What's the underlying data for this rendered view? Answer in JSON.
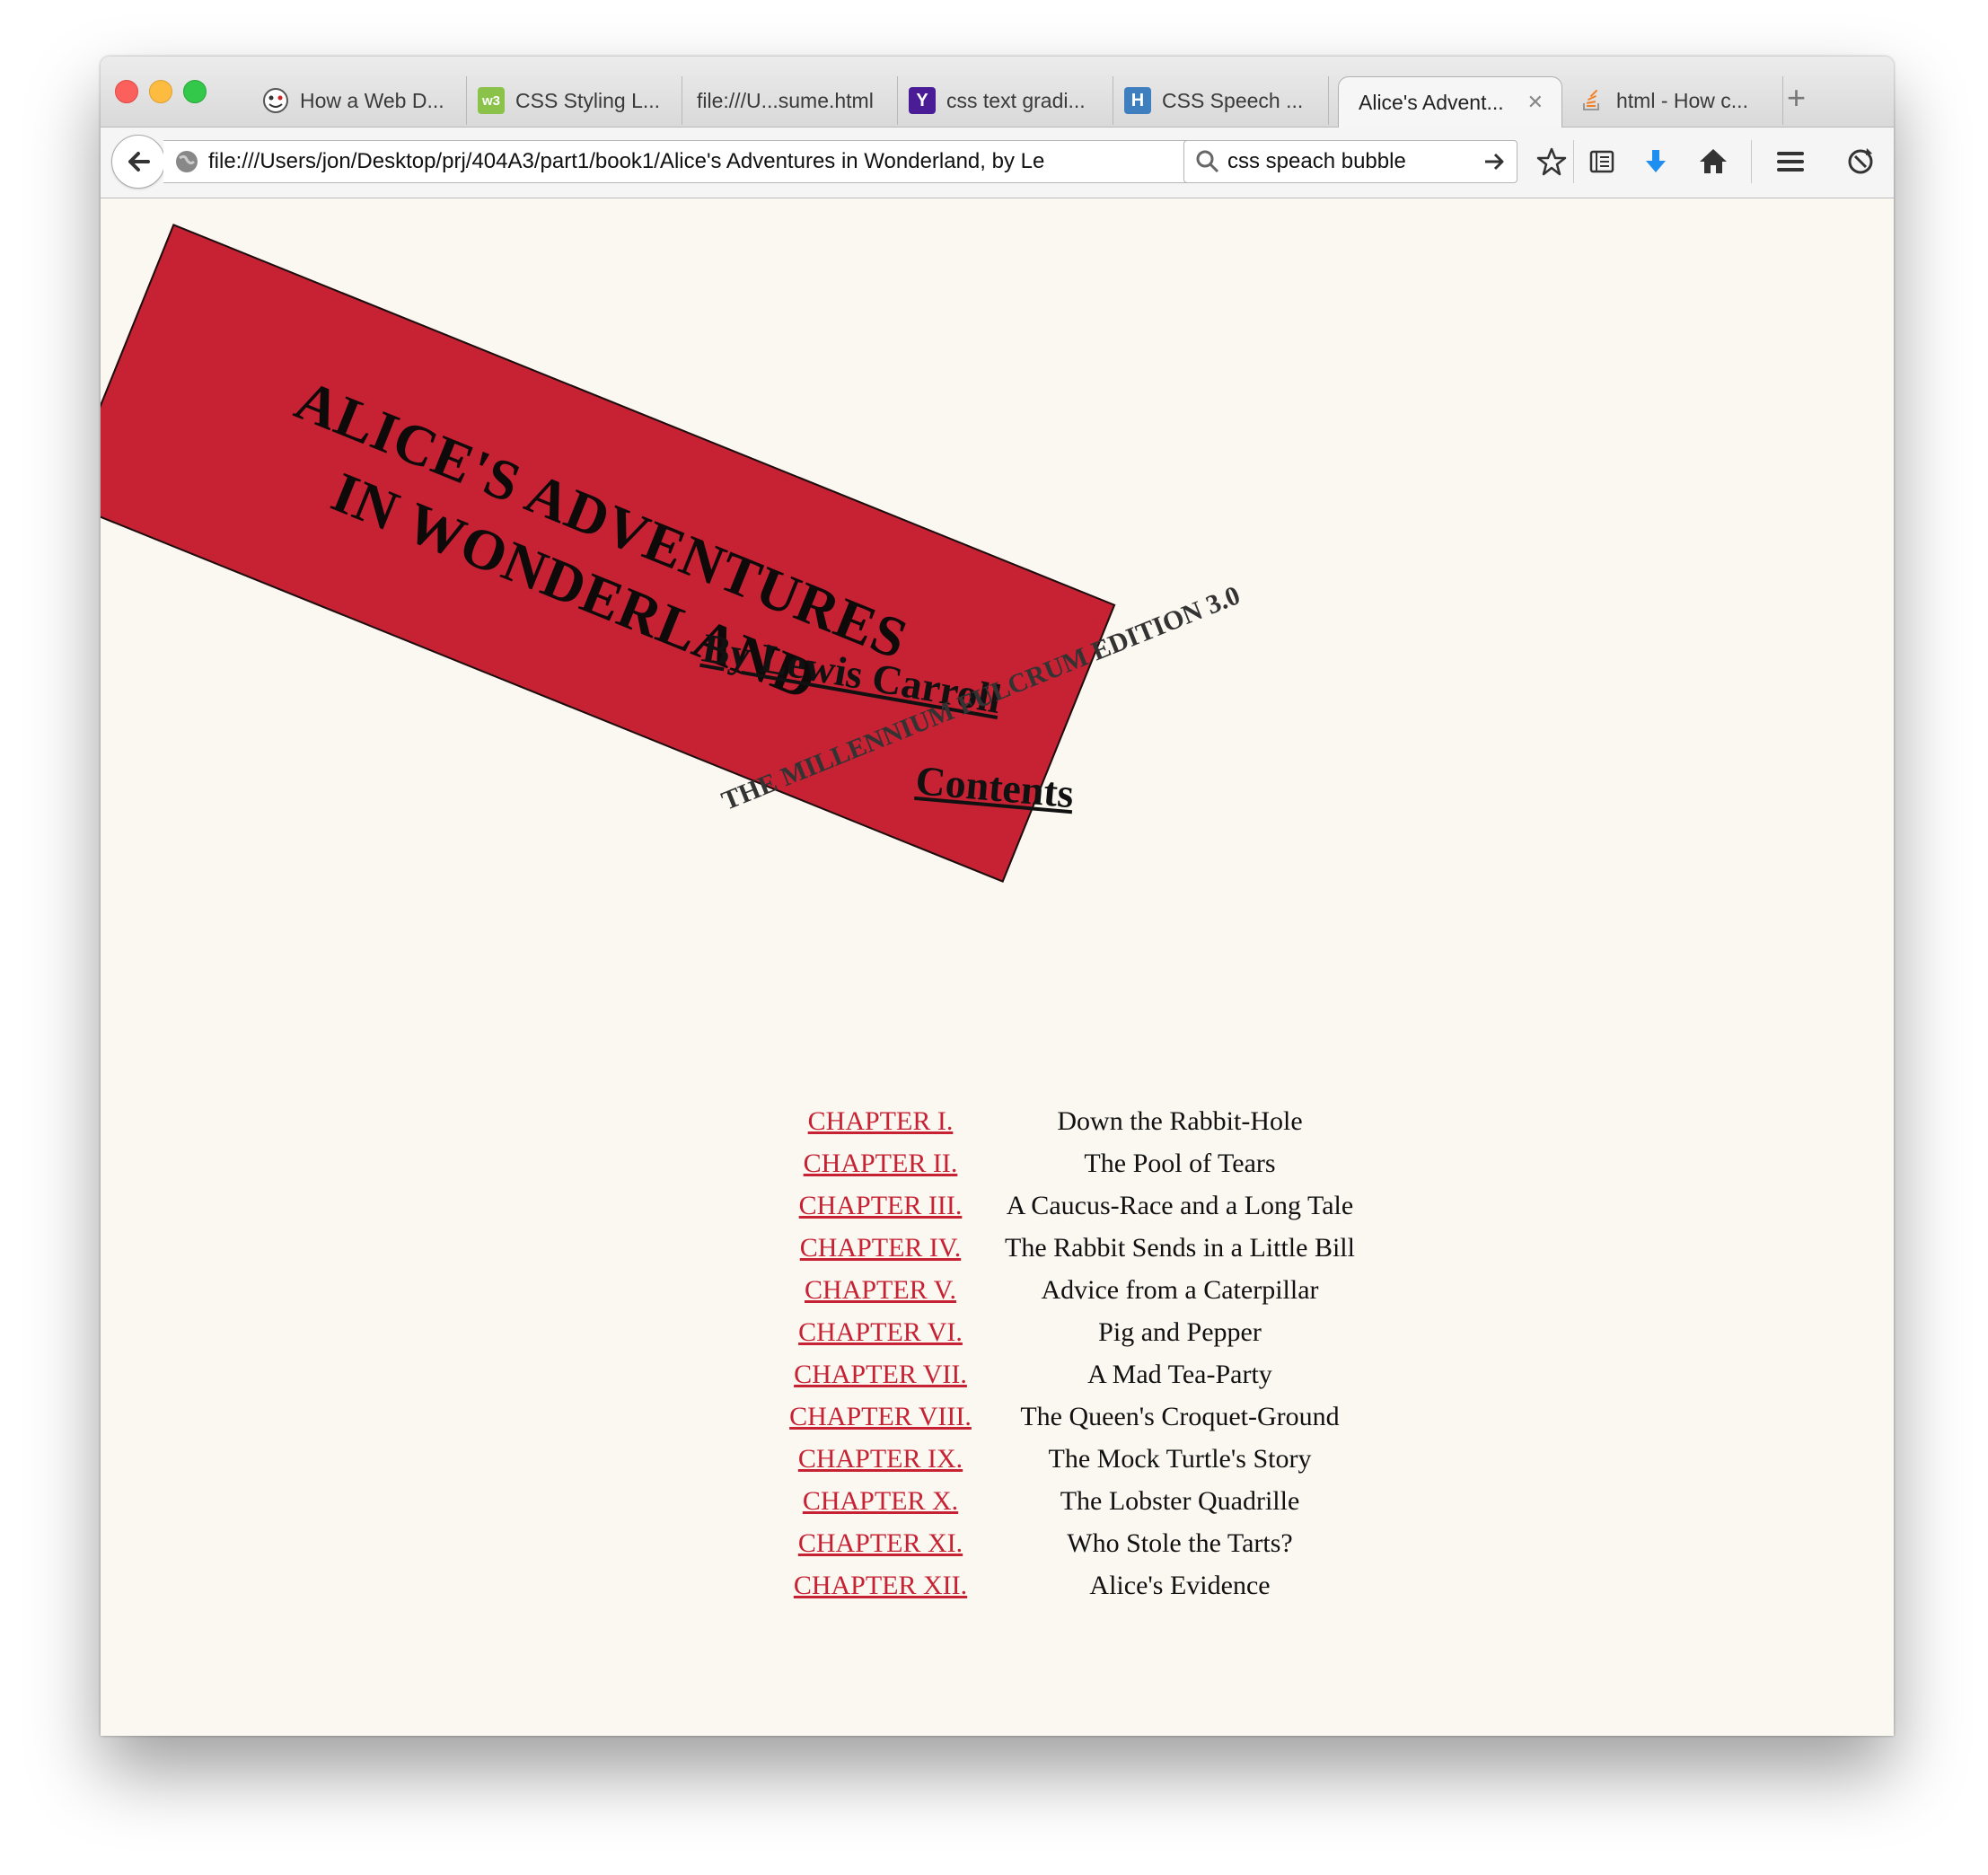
{
  "browser": {
    "tabs": [
      {
        "label": "How a Web D...",
        "icon": "ghost-face-icon",
        "active": false
      },
      {
        "label": "CSS Styling L...",
        "icon": "w3-schools-icon",
        "active": false
      },
      {
        "label": "file:///U...sume.html",
        "icon": "",
        "active": false
      },
      {
        "label": "css text gradi...",
        "icon": "yahoo-icon",
        "active": false
      },
      {
        "label": "CSS Speech ...",
        "icon": "h-icon",
        "active": false
      },
      {
        "label": "Alice's Advent...",
        "icon": "",
        "active": true
      },
      {
        "label": "html - How c...",
        "icon": "stackoverflow-icon",
        "active": false
      }
    ],
    "url": "file:///Users/jon/Desktop/prj/404A3/part1/book1/Alice's Adventures in Wonderland, by Le",
    "search_value": "css speach bubble",
    "colors": {
      "accent": "#c62234",
      "page_bg": "#faf8f1"
    }
  },
  "page": {
    "title_line1": "ALICE'S ADVENTURES",
    "title_line2": "IN WONDERLAND",
    "author": "By Lewis Carroll",
    "edition": "THE MILLENNIUM FULCRUM EDITION 3.0",
    "contents_heading": "Contents",
    "chapters": [
      {
        "label": "CHAPTER I.",
        "title": "Down the Rabbit-Hole"
      },
      {
        "label": "CHAPTER II.",
        "title": "The Pool of Tears"
      },
      {
        "label": "CHAPTER III.",
        "title": "A Caucus-Race and a Long Tale"
      },
      {
        "label": "CHAPTER IV.",
        "title": "The Rabbit Sends in a Little Bill"
      },
      {
        "label": "CHAPTER V.",
        "title": "Advice from a Caterpillar"
      },
      {
        "label": "CHAPTER VI.",
        "title": "Pig and Pepper"
      },
      {
        "label": "CHAPTER VII.",
        "title": "A Mad Tea-Party"
      },
      {
        "label": "CHAPTER VIII.",
        "title": "The Queen's Croquet-Ground"
      },
      {
        "label": "CHAPTER IX.",
        "title": "The Mock Turtle's Story"
      },
      {
        "label": "CHAPTER X.",
        "title": "The Lobster Quadrille"
      },
      {
        "label": "CHAPTER XI.",
        "title": "Who Stole the Tarts?"
      },
      {
        "label": "CHAPTER XII.",
        "title": "Alice's Evidence"
      }
    ]
  }
}
